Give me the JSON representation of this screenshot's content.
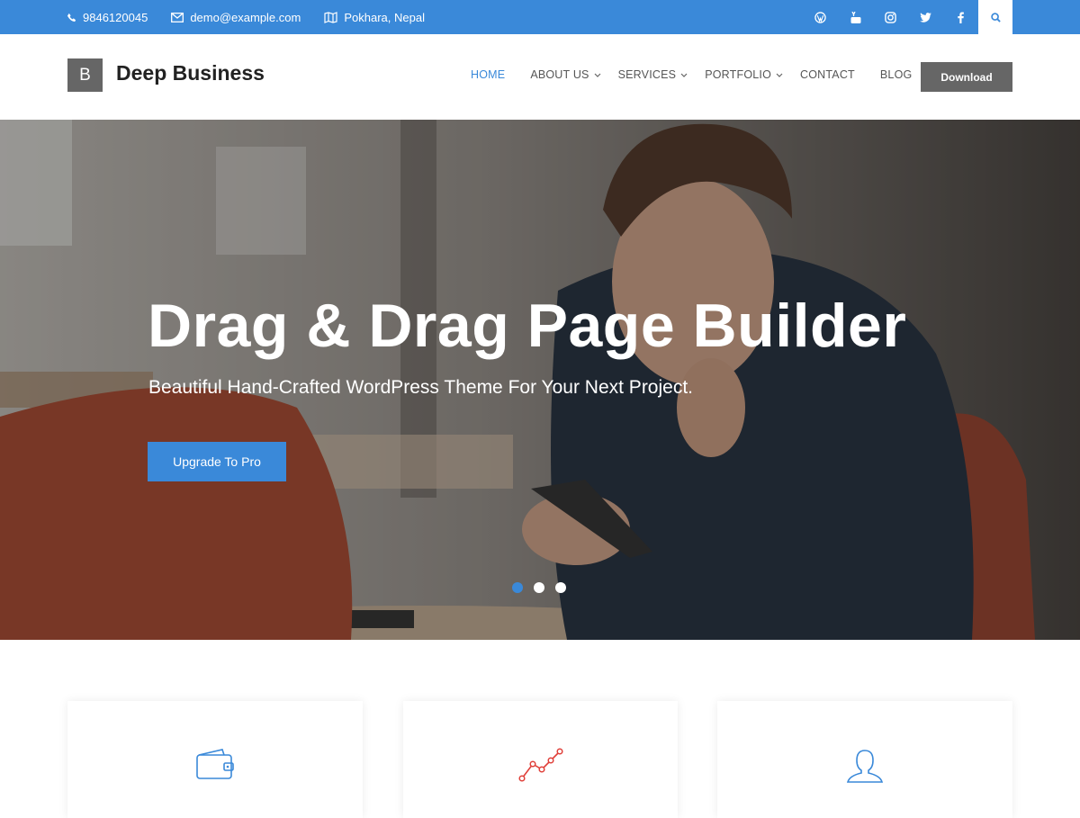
{
  "topbar": {
    "phone": "9846120045",
    "email": "demo@example.com",
    "location": "Pokhara, Nepal",
    "social_icons": [
      "wordpress-icon",
      "youtube-icon",
      "instagram-icon",
      "twitter-icon",
      "facebook-icon"
    ],
    "search_icon": "search-icon"
  },
  "header": {
    "logo_letter": "B",
    "site_title": "Deep Business",
    "nav": [
      {
        "label": "HOME",
        "active": true
      },
      {
        "label": "ABOUT US",
        "dropdown": true
      },
      {
        "label": "SERVICES",
        "dropdown": true
      },
      {
        "label": "PORTFOLIO",
        "dropdown": true
      },
      {
        "label": "CONTACT"
      },
      {
        "label": "BLOG"
      }
    ],
    "download_label": "Download"
  },
  "hero": {
    "title": "Drag & Drag Page Builder",
    "subtitle": "Beautiful Hand-Crafted WordPress Theme For Your Next Project.",
    "cta_label": "Upgrade To Pro",
    "slides": 3,
    "active_slide": 1
  },
  "cards": [
    {
      "icon": "wallet-icon"
    },
    {
      "icon": "line-chart-icon"
    },
    {
      "icon": "user-icon"
    }
  ],
  "colors": {
    "accent": "#3a89d9",
    "dark_button": "#666666",
    "chart_icon": "#e0403a"
  }
}
